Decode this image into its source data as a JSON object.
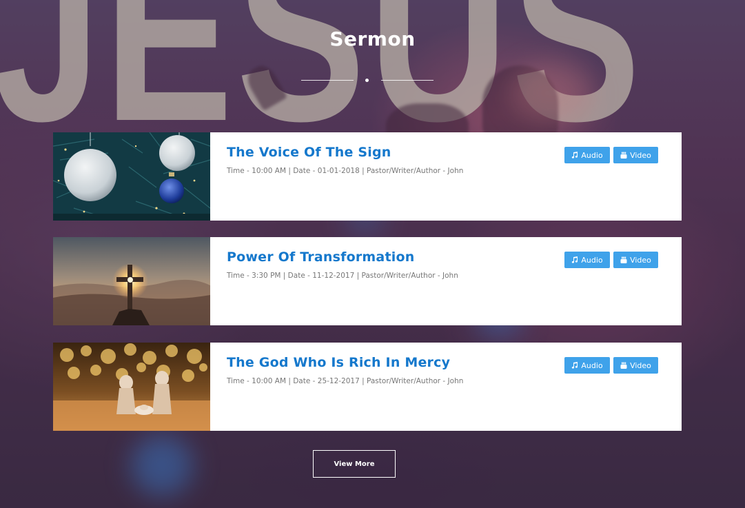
{
  "section": {
    "title": "Sermon"
  },
  "colors": {
    "title_blue": "#1578cc",
    "button_blue": "#3fa2ea",
    "meta_gray": "#777777"
  },
  "sermons": [
    {
      "title": "The Voice Of The Sign",
      "meta": "Time - 10:00 AM | Date - 01-01-2018 | Pastor/Writer/Author - John",
      "audio_label": "Audio",
      "video_label": "Video",
      "thumbnail": "christmas-ornaments-image"
    },
    {
      "title": "Power Of Transformation",
      "meta": "Time - 3:30 PM | Date - 11-12-2017 | Pastor/Writer/Author - John",
      "audio_label": "Audio",
      "video_label": "Video",
      "thumbnail": "cross-sunset-image"
    },
    {
      "title": "The God Who Is Rich In Mercy",
      "meta": "Time - 10:00 AM | Date - 25-12-2017 | Pastor/Writer/Author - John",
      "audio_label": "Audio",
      "video_label": "Video",
      "thumbnail": "nativity-figurines-image"
    }
  ],
  "icons": {
    "audio": "music-note-icon",
    "video": "youtube-icon"
  },
  "view_more_label": "View More"
}
